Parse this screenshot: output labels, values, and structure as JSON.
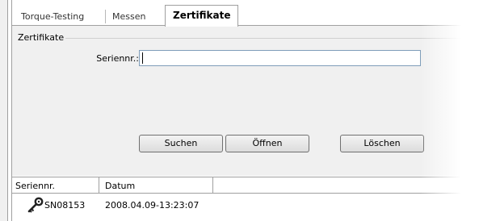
{
  "tabs": [
    {
      "label": "Torque-Testing",
      "active": false
    },
    {
      "label": "Messen",
      "active": false
    },
    {
      "label": "Zertifikate",
      "active": true
    }
  ],
  "certificates_group": {
    "label": "Zertifikate"
  },
  "serial_search": {
    "label": "Seriennr.:",
    "value": ""
  },
  "buttons": {
    "search": "Suchen",
    "open": "Öffnen",
    "delete": "Löschen"
  },
  "grid": {
    "columns": [
      "Seriennr.",
      "Datum"
    ],
    "rows": [
      {
        "icon": "key-icon",
        "serial": "SN08153",
        "date": "2008.04.09-13:23:07"
      }
    ]
  },
  "colors": {
    "panel": "#f0f0f0",
    "input_border": "#7f9db9",
    "divider": "#a0a0a0"
  }
}
